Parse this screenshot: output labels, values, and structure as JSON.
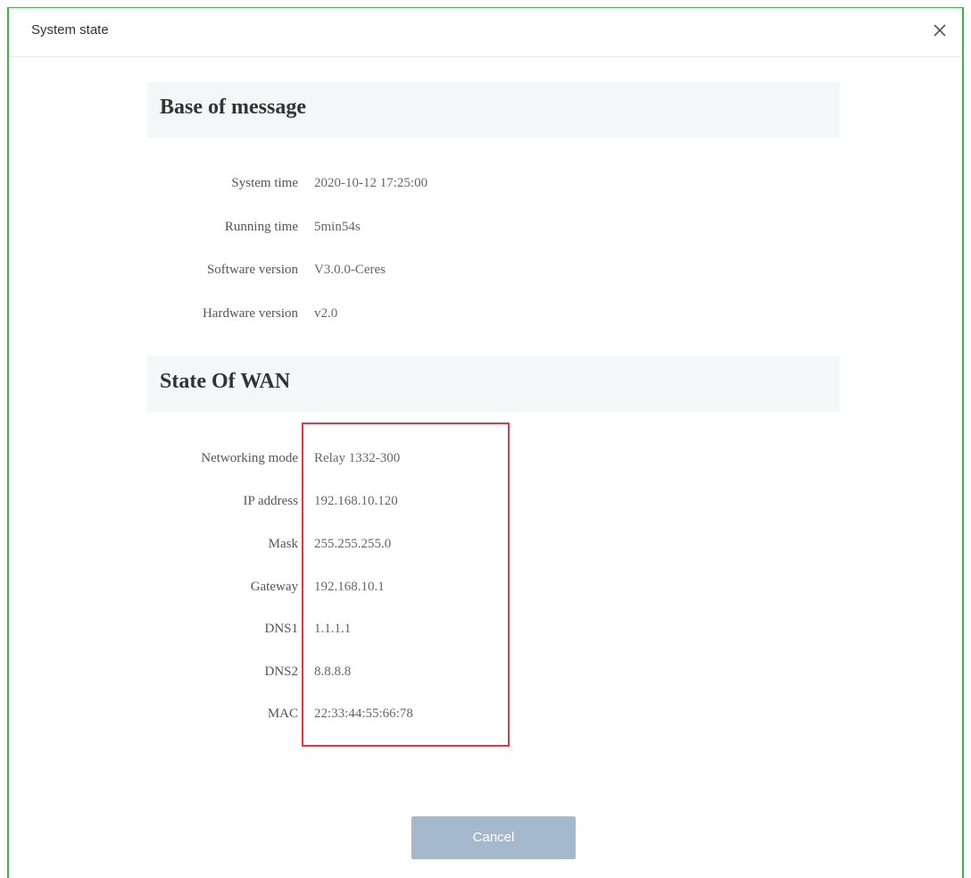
{
  "dialog": {
    "title": "System state",
    "close_icon": "close-icon",
    "cancel_label": "Cancel"
  },
  "base": {
    "heading": "Base of message",
    "rows": [
      {
        "label": "System time",
        "value": "2020-10-12 17:25:00"
      },
      {
        "label": "Running time",
        "value": "5min54s"
      },
      {
        "label": "Software version",
        "value": "V3.0.0-Ceres"
      },
      {
        "label": "Hardware version",
        "value": "v2.0"
      }
    ]
  },
  "wan": {
    "heading": "State Of WAN",
    "rows": [
      {
        "label": "Networking mode",
        "value": "Relay 1332-300"
      },
      {
        "label": "IP address",
        "value": "192.168.10.120"
      },
      {
        "label": "Mask",
        "value": "255.255.255.0"
      },
      {
        "label": "Gateway",
        "value": "192.168.10.1"
      },
      {
        "label": "DNS1",
        "value": "1.1.1.1"
      },
      {
        "label": "DNS2",
        "value": "8.8.8.8"
      },
      {
        "label": "MAC",
        "value": "22:33:44:55:66:78"
      }
    ]
  },
  "colors": {
    "dialog_border": "#3db34a",
    "highlight_box": "#e0393e",
    "cancel_button": "#a5b9cc",
    "section_bg": "#f4f6f8"
  }
}
